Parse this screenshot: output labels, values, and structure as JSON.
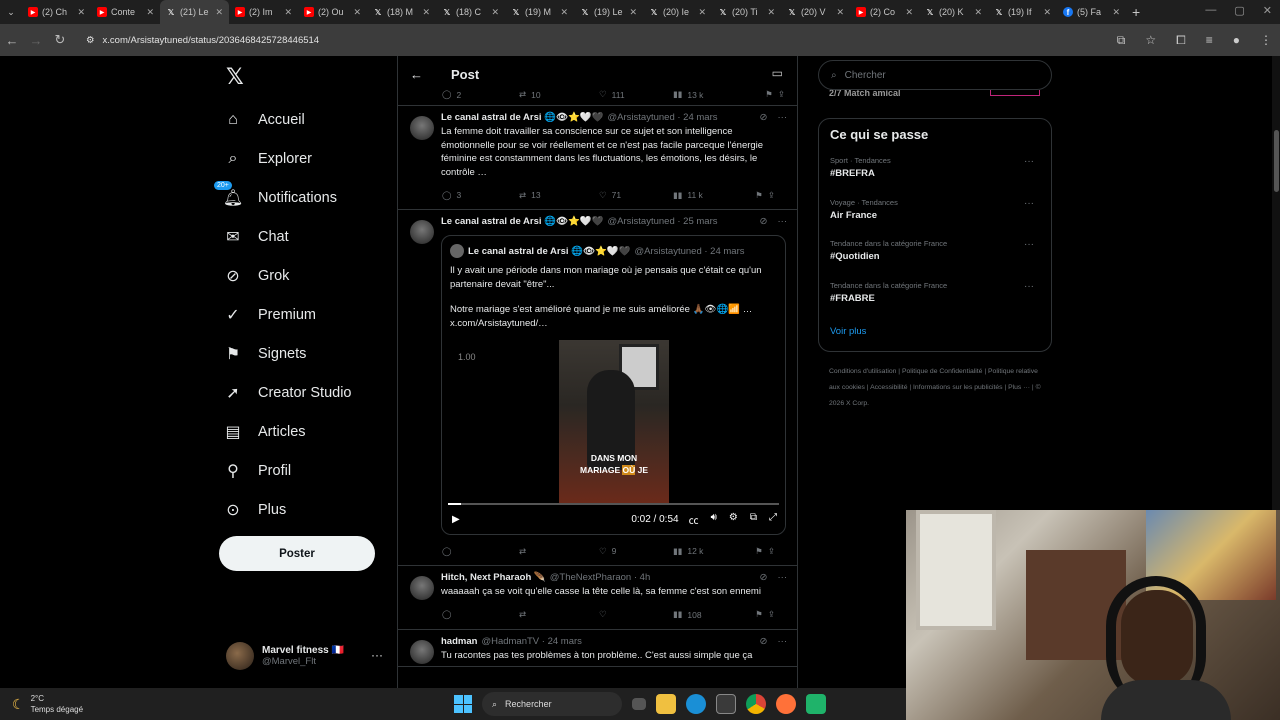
{
  "browser": {
    "tabs": [
      {
        "icon": "youtube",
        "label": "(2) Ch"
      },
      {
        "icon": "youtube",
        "label": "Conte"
      },
      {
        "icon": "x",
        "label": "(21) Le",
        "active": true
      },
      {
        "icon": "youtube",
        "label": "(2) Im"
      },
      {
        "icon": "youtube",
        "label": "(2) Ou"
      },
      {
        "icon": "x",
        "label": "(18) M"
      },
      {
        "icon": "x",
        "label": "(18) C"
      },
      {
        "icon": "x",
        "label": "(19) M"
      },
      {
        "icon": "x",
        "label": "(19) Le"
      },
      {
        "icon": "x",
        "label": "(20) Ie"
      },
      {
        "icon": "x",
        "label": "(20) Ti"
      },
      {
        "icon": "x",
        "label": "(20) V"
      },
      {
        "icon": "youtube",
        "label": "(2) Co"
      },
      {
        "icon": "x",
        "label": "(20) K"
      },
      {
        "icon": "x",
        "label": "(19) If"
      },
      {
        "icon": "facebook",
        "label": "(5) Fa"
      }
    ],
    "url": "x.com/Arsistaytuned/status/2036468425728446514"
  },
  "sidebar": {
    "items": [
      {
        "label": "Accueil",
        "icon": "home-icon"
      },
      {
        "label": "Explorer",
        "icon": "search-icon"
      },
      {
        "label": "Notifications",
        "icon": "bell-icon",
        "badge": "20+"
      },
      {
        "label": "Chat",
        "icon": "mail-icon"
      },
      {
        "label": "Grok",
        "icon": "grok-icon"
      },
      {
        "label": "Premium",
        "icon": "verified-icon"
      },
      {
        "label": "Signets",
        "icon": "bookmark-icon"
      },
      {
        "label": "Creator Studio",
        "icon": "rocket-icon"
      },
      {
        "label": "Articles",
        "icon": "article-icon"
      },
      {
        "label": "Profil",
        "icon": "person-icon"
      },
      {
        "label": "Plus",
        "icon": "more-circle-icon"
      }
    ],
    "post_button": "Poster",
    "account": {
      "name": "Marvel fitness 🇫🇷",
      "handle": "@Marvel_Flt"
    }
  },
  "feed": {
    "title": "Post",
    "top_actions": {
      "replies": "2",
      "reposts": "10",
      "likes": "111",
      "views": "13 k"
    },
    "tweets": [
      {
        "name": "Le canal astral de Arsi 🌐👁⭐🤍🖤",
        "meta": "@Arsistaytuned · 24 mars",
        "text": "La femme doit travailler sa conscience sur ce sujet et son intelligence émotionnelle pour se voir réellement et ce n'est pas facile parceque l'énergie féminine est constamment dans les fluctuations, les émotions, les désirs, le contrôle …",
        "replies": "3",
        "reposts": "13",
        "likes": "71",
        "views": "11 k"
      },
      {
        "name": "Le canal astral de Arsi 🌐👁⭐🤍🖤",
        "meta": "@Arsistaytuned · 25 mars",
        "quote": {
          "name": "Le canal astral de Arsi 🌐👁⭐🤍🖤",
          "meta": "@Arsistaytuned · 24 mars",
          "text1": "Il y avait une période dans mon mariage où je pensais que c'était ce qu'un partenaire devait \"être\"...",
          "text2": "Notre mariage s'est amélioré quand je me suis améliorée 🙏🏾👁🌐📶 … x.com/Arsistaytuned/…",
          "video": {
            "speed": "1.00",
            "caption1": "DANS MON",
            "caption2a": "MARIAGE ",
            "caption2b": "OÙ",
            "caption2c": " JE",
            "time": "0:02 / 0:54",
            "progress": 0.04
          }
        },
        "replies": "",
        "reposts": "",
        "likes": "9",
        "views": "12 k"
      },
      {
        "name": "Hitch, Next Pharaoh 🪶",
        "meta": "@TheNextPharaon · 4h",
        "text": "waaaaah ça se voit qu'elle casse la tête celle là, sa femme c'est son ennemi",
        "replies": "",
        "reposts": "",
        "likes": "",
        "views": "108"
      },
      {
        "name": "hadman",
        "meta": "@HadmanTV · 24 mars",
        "text": "Tu racontes pas tes problèmes à ton problème.. C'est aussi simple que ça"
      }
    ]
  },
  "right": {
    "search_placeholder": "Chercher",
    "match_text": "2/7 Match amical",
    "trends_title": "Ce qui se passe",
    "trends": [
      {
        "category": "Sport · Tendances",
        "tag": "#BREFRA"
      },
      {
        "category": "Voyage · Tendances",
        "tag": "Air France"
      },
      {
        "category": "Tendance dans la catégorie France",
        "tag": "#Quotidien"
      },
      {
        "category": "Tendance dans la catégorie France",
        "tag": "#FRABRE"
      }
    ],
    "see_more": "Voir plus",
    "footer": [
      "Conditions d'utilisation",
      "Politique de Confidentialité",
      "Politique relative aux cookies",
      "Accessibilité",
      "Informations sur les publicités",
      "Plus ···",
      "© 2026 X Corp."
    ]
  },
  "taskbar": {
    "temp": "2°C",
    "weather": "Temps dégagé",
    "search": "Rechercher"
  }
}
